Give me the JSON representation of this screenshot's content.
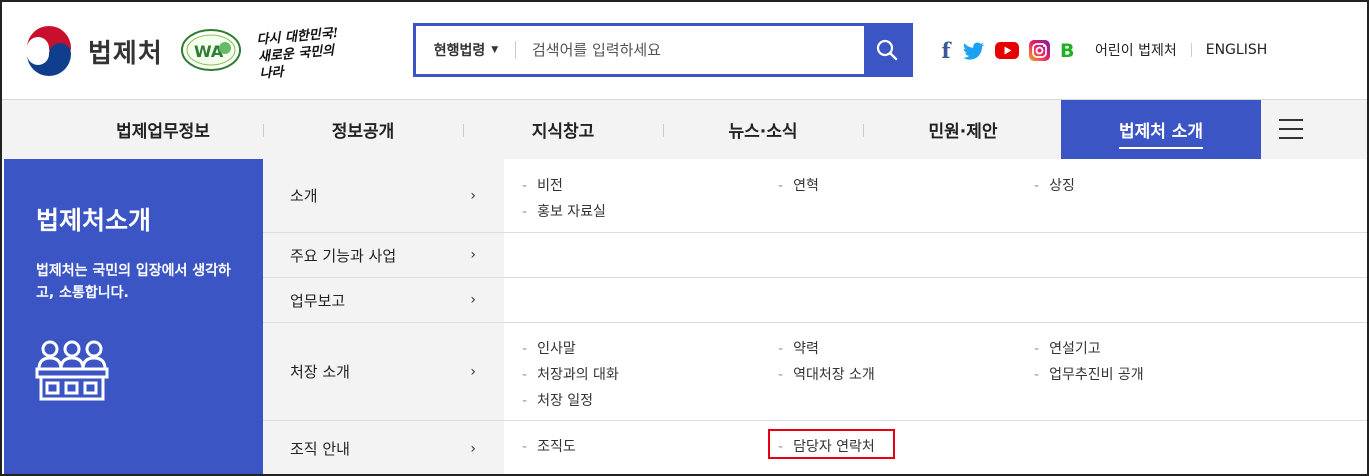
{
  "header": {
    "logo_text": "법제처",
    "slogan_line1": "다시 대한민국!",
    "slogan_line2": "새로운 국민의 나라",
    "search": {
      "scope_label": "현행법령",
      "placeholder": "검색어를 입력하세요"
    },
    "social_icons": [
      "facebook-icon",
      "twitter-icon",
      "youtube-icon",
      "instagram-icon",
      "blog-icon"
    ],
    "facebook_glyph": "f",
    "blog_glyph": "B",
    "links": {
      "kids": "어린이 법제처",
      "english": "ENGLISH"
    }
  },
  "gnb": {
    "items": [
      {
        "label": "법제업무정보"
      },
      {
        "label": "정보공개"
      },
      {
        "label": "지식창고"
      },
      {
        "label": "뉴스·소식"
      },
      {
        "label": "민원·제안"
      },
      {
        "label": "법제처 소개",
        "active": true
      }
    ]
  },
  "lnb": {
    "title": "법제처소개",
    "description": "법제처는 국민의 입장에서 생각하고, 소통합니다."
  },
  "menu": {
    "chevron": "›",
    "rows": [
      {
        "label": "소개",
        "links": [
          "비전",
          "연혁",
          "상징",
          "홍보 자료실"
        ]
      },
      {
        "label": "주요 기능과 사업",
        "links": []
      },
      {
        "label": "업무보고",
        "links": []
      },
      {
        "label": "처장 소개",
        "links": [
          "인사말",
          "약력",
          "연설기고",
          "처장과의 대화",
          "역대처장 소개",
          "업무추진비 공개",
          "처장 일정"
        ]
      },
      {
        "label": "조직 안내",
        "links": [
          "조직도",
          "담당자 연락처"
        ]
      }
    ]
  },
  "colors": {
    "brand_blue": "#3b55c5",
    "highlight_red": "#e60012"
  }
}
